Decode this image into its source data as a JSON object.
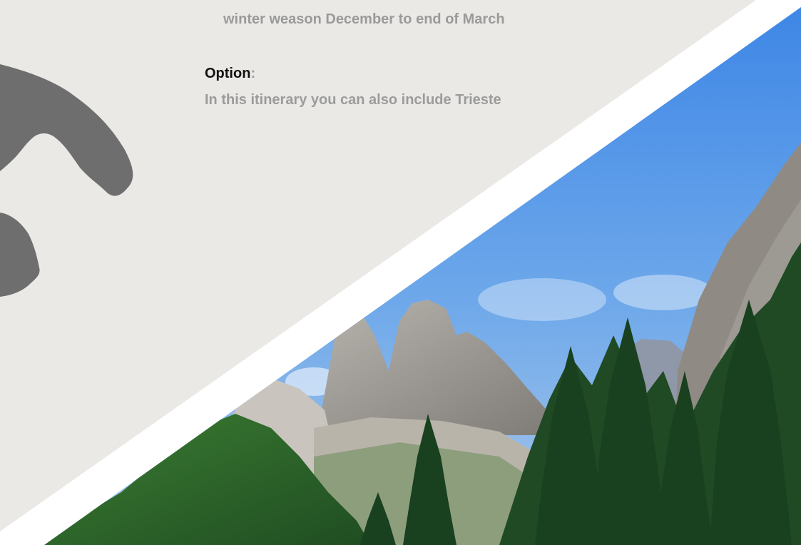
{
  "content": {
    "season_line": "winter weason December to end of March",
    "option": {
      "heading": "Option",
      "colon": ":",
      "text": "In this itinerary you can also include Trieste"
    }
  },
  "photo": {
    "subject": "mountain-forest-photo"
  },
  "colors": {
    "background": "#ebe9e6",
    "map_silhouette": "#6e6e6e",
    "divider_band": "#ffffff",
    "sky": "#5a9ae0",
    "forest": "#2e6a2e"
  }
}
